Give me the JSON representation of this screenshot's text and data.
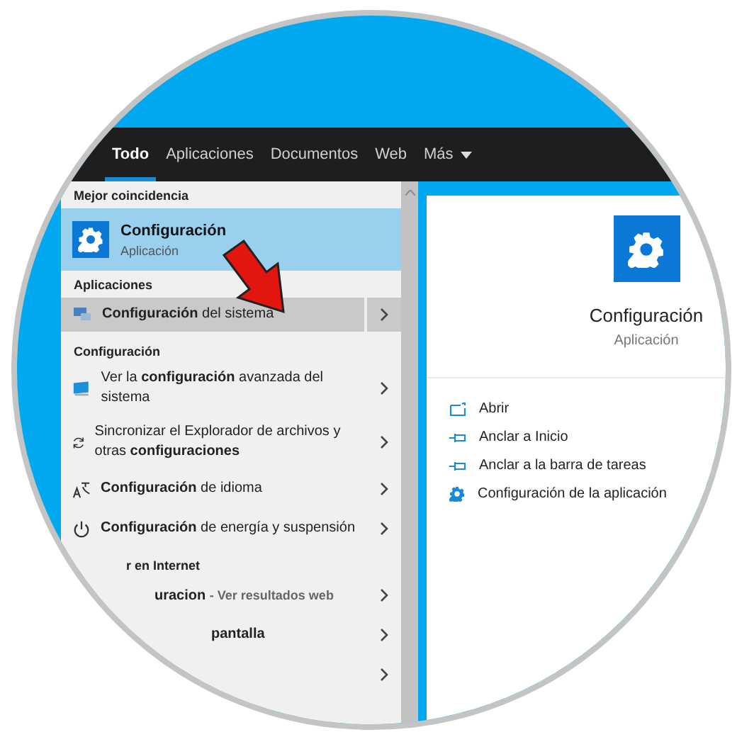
{
  "tabs": [
    {
      "label": "Todo",
      "selected": true,
      "kind": "plain"
    },
    {
      "label": "Aplicaciones",
      "selected": false,
      "kind": "plain"
    },
    {
      "label": "Documentos",
      "selected": false,
      "kind": "plain"
    },
    {
      "label": "Web",
      "selected": false,
      "kind": "plain"
    },
    {
      "label": "Más",
      "selected": false,
      "kind": "menu"
    }
  ],
  "sections": [
    {
      "header": "Mejor coincidencia",
      "items": [
        {
          "kind": "best",
          "text": "Configuración",
          "subtitle": "Aplicación",
          "selected": true
        }
      ]
    },
    {
      "header": "Aplicaciones",
      "items": [
        {
          "kind": "app",
          "text": "**Configuración** del sistema",
          "selected": true
        }
      ]
    },
    {
      "header": "Configuración",
      "items": [
        {
          "kind": "app",
          "text": "Ver la **configuración** avanzada del sistema",
          "selected": false
        },
        {
          "kind": "app",
          "text": "Sincronizar el Explorador de archivos y otras **configuraciones**",
          "selected": false
        },
        {
          "kind": "app",
          "text": "**Configuración** de idioma",
          "selected": false
        },
        {
          "kind": "app",
          "text": "**Configuración** de energía y suspensión",
          "selected": false
        }
      ]
    },
    {
      "header": "r en Internet",
      "items": [
        {
          "kind": "web",
          "text": "uracion",
          "note": "- Ver resultados web",
          "selected": false
        },
        {
          "kind": "web",
          "text": "pantalla",
          "selected": false
        },
        {
          "kind": "web",
          "selected": false
        }
      ]
    }
  ],
  "preview": {
    "title": "Configuración",
    "subtitle": "Aplicación",
    "actions": [
      "Abrir",
      "Anclar a Inicio",
      "Anclar a la barra de tareas",
      "Configuración de la aplicación"
    ]
  }
}
